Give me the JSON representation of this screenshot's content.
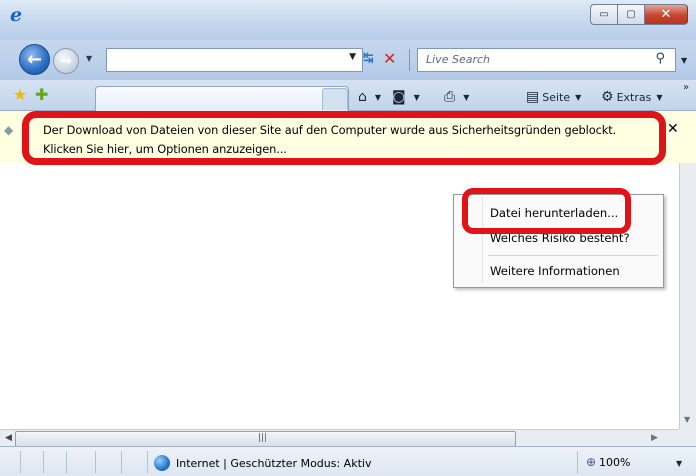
{
  "titlebar": {
    "logo_glyph": "e",
    "minimize_glyph": "▭",
    "maximize_glyph": "▢",
    "close_glyph": "✕"
  },
  "nav": {
    "back_glyph": "←",
    "forward_glyph": "→",
    "address_value": "",
    "search_placeholder": "Live Search"
  },
  "commandbar": {
    "page_label": "Seite",
    "tools_label": "Extras"
  },
  "infobar": {
    "line1": "Der Download von Dateien von dieser Site auf den Computer wurde aus Sicherheitsgründen geblockt.",
    "line2": "Klicken Sie hier, um Optionen anzuzeigen...",
    "close_glyph": "✕"
  },
  "context_menu": {
    "items": [
      {
        "label": "Datei herunterladen..."
      },
      {
        "label": "Welches Risiko besteht?"
      },
      {
        "label": "Weitere Informationen"
      }
    ]
  },
  "statusbar": {
    "zone_text": "Internet | Geschützter Modus: Aktiv",
    "zoom": "100%"
  },
  "colors": {
    "highlight": "#e01418",
    "infobar_bg": "#ffffe1",
    "chrome": "#c5d8ef"
  },
  "icons": [
    "ie-logo-icon",
    "back-icon",
    "forward-icon",
    "refresh-icon",
    "stop-icon",
    "search-icon",
    "favorites-star-icon",
    "add-favorites-icon",
    "home-icon",
    "feeds-icon",
    "print-icon",
    "page-icon",
    "tools-gear-icon",
    "shield-icon",
    "close-icon",
    "globe-icon",
    "zoom-icon"
  ]
}
